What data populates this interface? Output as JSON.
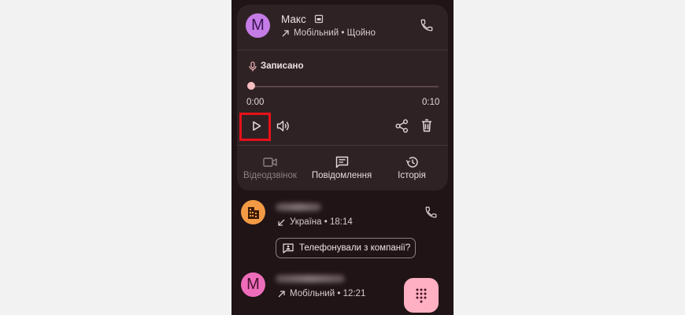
{
  "contact": {
    "avatar_letter": "М",
    "name": "Макс",
    "subtitle": "Мобільний • Щойно"
  },
  "recording": {
    "label": "Записано",
    "current_time": "0:00",
    "duration": "0:10",
    "progress_fraction": 0.0
  },
  "actions": [
    {
      "label": "Відеодзвінок",
      "icon": "video-call-icon",
      "enabled": false
    },
    {
      "label": "Повідомлення",
      "icon": "message-icon",
      "enabled": true
    },
    {
      "label": "Історія",
      "icon": "history-icon",
      "enabled": true
    }
  ],
  "call_list": [
    {
      "subtitle": "Україна • 18:14",
      "direction": "incoming",
      "icon": "business-building-icon"
    },
    {
      "avatar_letter": "М",
      "subtitle": "Мобільний • 12:21",
      "direction": "outgoing"
    }
  ],
  "company_chip": {
    "label": "Телефонували з компанії?"
  },
  "colors": {
    "background": "#201416",
    "card": "#2f2224",
    "accent": "#f6bfc3",
    "fab": "#ffb0c2",
    "highlight": "#e8111a"
  }
}
